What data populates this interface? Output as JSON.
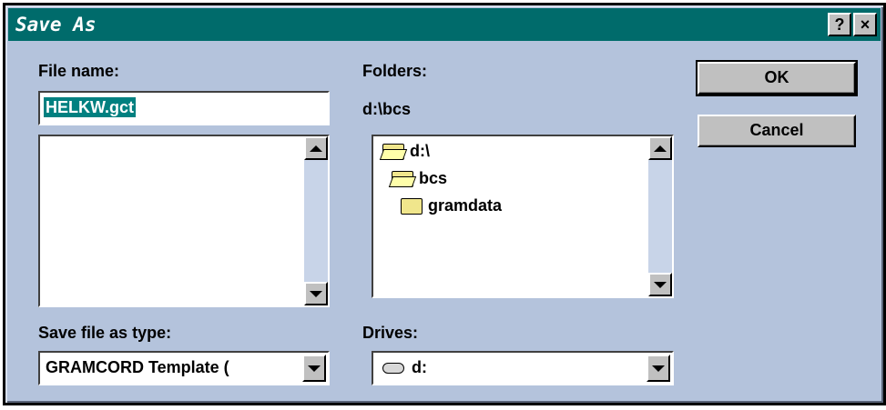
{
  "window": {
    "title": "Save As",
    "help_label": "?",
    "close_label": "×"
  },
  "file_name": {
    "label": "File name:",
    "value": "HELKW.gct"
  },
  "folders": {
    "label": "Folders:",
    "current_path": "d:\\bcs",
    "tree": [
      {
        "name": "d:\\",
        "icon": "open-folder-icon"
      },
      {
        "name": "bcs",
        "icon": "open-folder-icon"
      },
      {
        "name": "gramdata",
        "icon": "folder-icon"
      }
    ]
  },
  "save_type": {
    "label": "Save file as type:",
    "value": "GRAMCORD Template ("
  },
  "drives": {
    "label": "Drives:",
    "value": "d:"
  },
  "buttons": {
    "ok": "OK",
    "cancel": "Cancel"
  },
  "colors": {
    "titlebar": "#006b6b",
    "dialog_bg": "#b4c3dc",
    "selection": "#008080"
  }
}
